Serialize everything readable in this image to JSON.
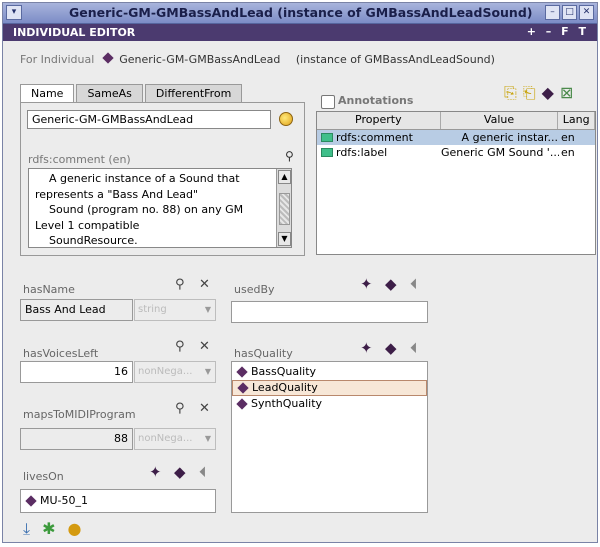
{
  "window": {
    "title": "Generic-GM-GMBassAndLead   (instance of GMBassAndLeadSound)",
    "menu_glyph": "▾",
    "buttons": [
      "–",
      "□",
      "✕"
    ]
  },
  "panel": {
    "title": "INDIVIDUAL EDITOR",
    "controls": "+ – F T"
  },
  "for_line": {
    "label": "For Individual",
    "name": "Generic-GM-GMBassAndLead",
    "type": "(instance of GMBassAndLeadSound)"
  },
  "tabs": [
    "Name",
    "SameAs",
    "DifferentFrom"
  ],
  "name_field": "Generic-GM-GMBassAndLead",
  "comment": {
    "label": "rdfs:comment (en)",
    "text": "    A generic instance of a Sound that represents a \"Bass And Lead\"\n    Sound (program no. 88) on any GM Level 1 compatible\n    SoundResource."
  },
  "annotations": {
    "label": "Annotations",
    "columns": [
      "Property",
      "Value",
      "Lang"
    ],
    "rows": [
      {
        "property": "rdfs:comment",
        "value": "A generic instar...",
        "lang": "en"
      },
      {
        "property": "rdfs:label",
        "value": "Generic GM Sound '...",
        "lang": "en"
      }
    ],
    "icons": [
      "add-annotation-icon",
      "add-property-icon",
      "add-value-icon",
      "delete-annotation-icon"
    ]
  },
  "slots": {
    "has_name": {
      "label": "hasName",
      "value": "Bass And Lead",
      "type": "string"
    },
    "has_voices_left": {
      "label": "hasVoicesLeft",
      "value": "16",
      "type": "nonNega..."
    },
    "maps_to_midi": {
      "label": "mapsToMIDIProgram",
      "value": "88",
      "type": "nonNega..."
    },
    "lives_on": {
      "label": "livesOn",
      "items": [
        "MU-50_1"
      ]
    },
    "used_by": {
      "label": "usedBy",
      "items": []
    },
    "has_quality": {
      "label": "hasQuality",
      "items": [
        "BassQuality",
        "LeadQuality",
        "SynthQuality"
      ],
      "selected": 1
    }
  },
  "icons": {
    "search": "⚲",
    "delete": "✕",
    "create": "✦",
    "add": "◆",
    "remove": "⏴",
    "bottom": [
      "export-icon",
      "bug-icon",
      "add-instance-icon"
    ]
  }
}
